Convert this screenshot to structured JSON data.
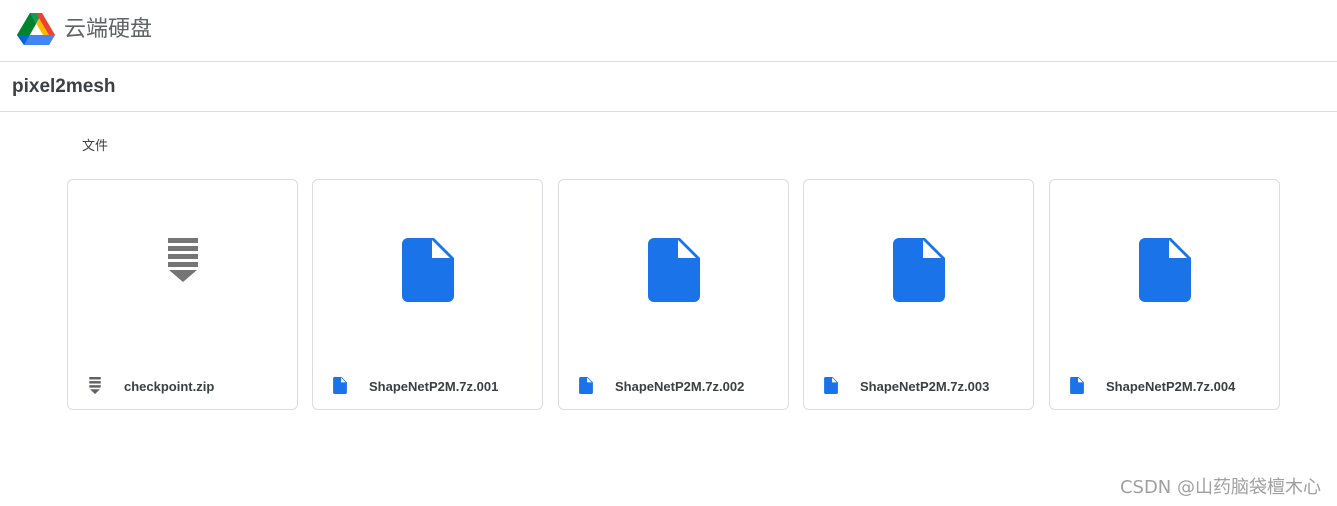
{
  "header": {
    "app_title": "云端硬盘"
  },
  "folder": {
    "title": "pixel2mesh"
  },
  "section": {
    "label": "文件"
  },
  "files": [
    {
      "name": "checkpoint.zip",
      "icon": "archive-icon"
    },
    {
      "name": "ShapeNetP2M.7z.001",
      "icon": "file-icon"
    },
    {
      "name": "ShapeNetP2M.7z.002",
      "icon": "file-icon"
    },
    {
      "name": "ShapeNetP2M.7z.003",
      "icon": "file-icon"
    },
    {
      "name": "ShapeNetP2M.7z.004",
      "icon": "file-icon"
    }
  ],
  "watermark": "CSDN @山药脑袋檀木心",
  "colors": {
    "file_blue": "#1a73e8",
    "archive_gray": "#757575",
    "border": "#dadce0"
  }
}
